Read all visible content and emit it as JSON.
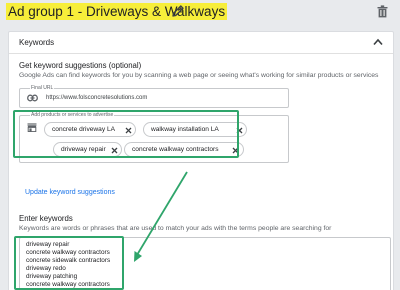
{
  "header": {
    "ad_group_title": "Ad group 1 - Driveways & Walkways"
  },
  "card": {
    "title": "Keywords"
  },
  "suggestions": {
    "title": "Get keyword suggestions (optional)",
    "description": "Google Ads can find keywords for you by scanning a web page or seeing what's working for similar products or services",
    "final_url_label": "Final URL",
    "final_url_value": "https://www.folsconcretesolutions.com",
    "products_label": "Add products or services to advertise",
    "chips": [
      "concrete driveway LA",
      "walkway installation LA",
      "driveway repair",
      "concrete walkway contractors"
    ],
    "update_link": "Update keyword suggestions"
  },
  "enter_keywords": {
    "title": "Enter keywords",
    "description": "Keywords are words or phrases that are used to match your ads with the terms people are searching for",
    "keywords": [
      "driveway repair",
      "concrete walkway contractors",
      "concrete sidewalk contractors",
      "driveway redo",
      "driveway patching",
      "concrete walkway contractors"
    ]
  },
  "colors": {
    "highlight": "#f7ee3a",
    "annotation": "#2fa56b",
    "link": "#1a73e8"
  }
}
